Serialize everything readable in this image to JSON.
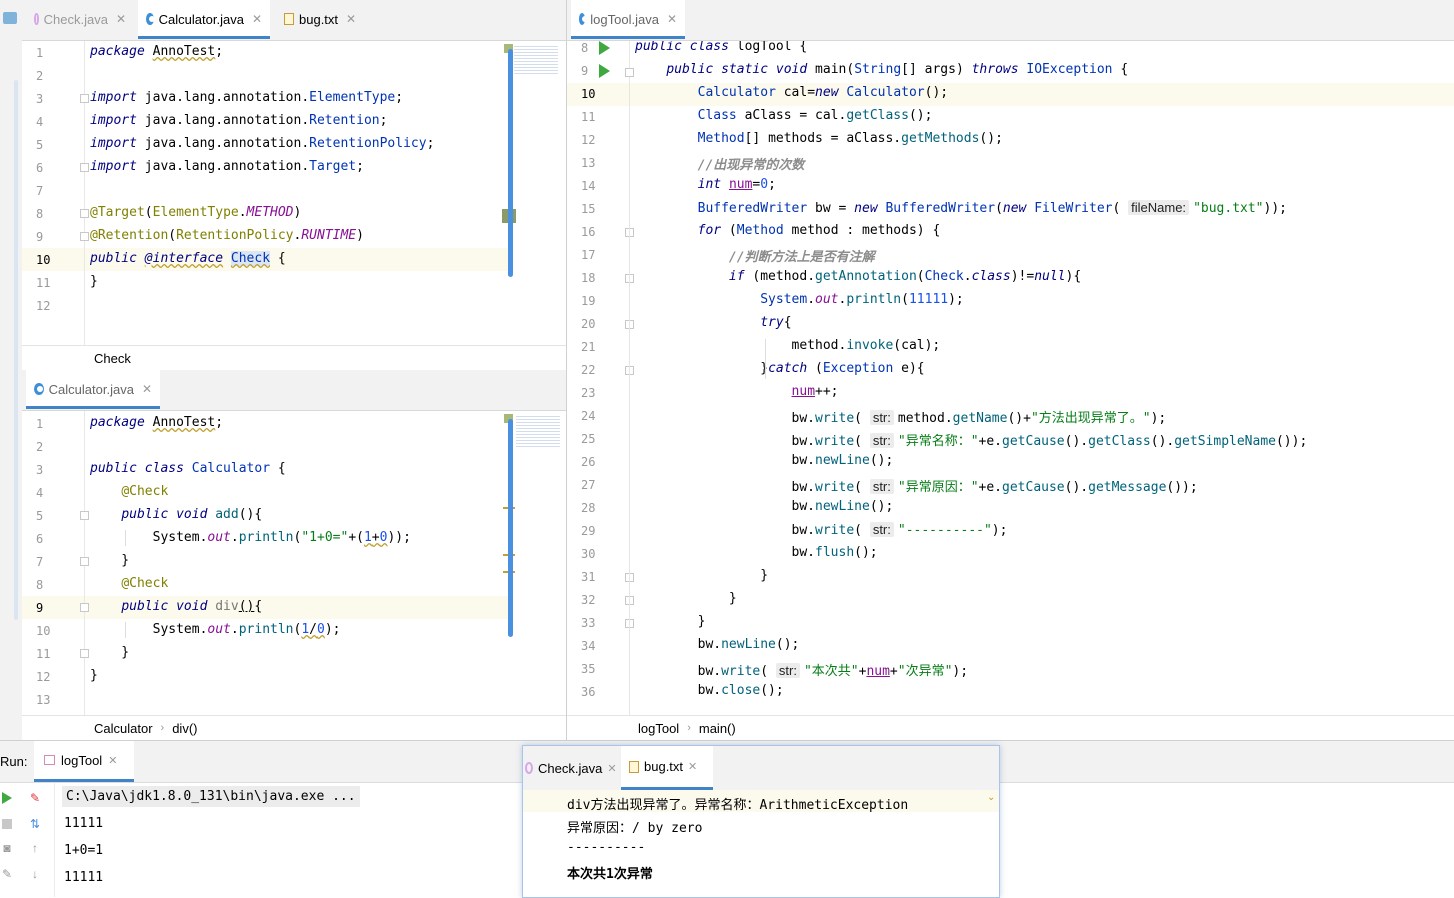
{
  "left_top_editor": {
    "tabs": [
      {
        "label": "Check.java",
        "icon": "annotation-icon",
        "state": "inactive"
      },
      {
        "label": "Calculator.java",
        "icon": "java-class-icon",
        "state": "active"
      },
      {
        "label": "bug.txt",
        "icon": "text-file-icon",
        "state": "inactive"
      }
    ],
    "line_numbers": [
      "1",
      "2",
      "3",
      "4",
      "5",
      "6",
      "7",
      "8",
      "9",
      "10",
      "11",
      "12"
    ],
    "lines": [
      "package AnnoTest;",
      "",
      "import java.lang.annotation.ElementType;",
      "import java.lang.annotation.Retention;",
      "import java.lang.annotation.RetentionPolicy;",
      "import java.lang.annotation.Target;",
      "",
      "@Target(ElementType.METHOD)",
      "@Retention(RetentionPolicy.RUNTIME)",
      "public @interface Check {",
      "}",
      ""
    ],
    "current_line": "10",
    "breadcrumb": [
      "Check"
    ]
  },
  "left_bottom_editor": {
    "tabs": [
      {
        "label": "Calculator.java",
        "icon": "java-class-icon",
        "state": "active"
      }
    ],
    "line_numbers": [
      "1",
      "2",
      "3",
      "4",
      "5",
      "6",
      "7",
      "8",
      "9",
      "10",
      "11",
      "12",
      "13"
    ],
    "lines": [
      "package AnnoTest;",
      "",
      "public class Calculator {",
      "    @Check",
      "    public void add(){",
      "        System.out.println(\"1+0=\"+(1+0));",
      "    }",
      "    @Check",
      "    public void div(){",
      "        System.out.println(1/0);",
      "    }",
      "}",
      ""
    ],
    "current_line": "9",
    "breadcrumb": [
      "Calculator",
      "div()"
    ]
  },
  "right_editor": {
    "tabs": [
      {
        "label": "logTool.java",
        "icon": "java-class-icon",
        "state": "active"
      }
    ],
    "line_numbers": [
      "8",
      "9",
      "10",
      "11",
      "12",
      "13",
      "14",
      "15",
      "16",
      "17",
      "18",
      "19",
      "20",
      "21",
      "22",
      "23",
      "24",
      "25",
      "26",
      "27",
      "28",
      "29",
      "30",
      "31",
      "32",
      "33",
      "34",
      "35",
      "36"
    ],
    "lines": [
      "public class logTool {",
      "    public static void main(String[] args) throws IOException {",
      "        Calculator cal=new Calculator();",
      "        Class aClass = cal.getClass();",
      "        Method[] methods = aClass.getMethods();",
      "        //出现异常的次数",
      "        int num=0;",
      "        BufferedWriter bw = new BufferedWriter(new FileWriter( fileName: \"bug.txt\"));",
      "        for (Method method : methods) {",
      "            //判断方法上是否有注解",
      "            if (method.getAnnotation(Check.class)!=null){",
      "                System.out.println(11111);",
      "                try{",
      "                    method.invoke(cal);",
      "                }catch (Exception e){",
      "                    num++;",
      "                    bw.write( str: method.getName()+\"方法出现异常了。\");",
      "                    bw.write( str: \"异常名称：\"+e.getCause().getClass().getSimpleName());",
      "                    bw.newLine();",
      "                    bw.write( str: \"异常原因：\"+e.getCause().getMessage());",
      "                    bw.newLine();",
      "                    bw.write( str: \"----------\");",
      "                    bw.flush();",
      "                }",
      "            }",
      "        }",
      "        bw.newLine();",
      "        bw.write( str: \"本次共\"+num+\"次异常\");",
      "        bw.close();"
    ],
    "current_line": "10",
    "breadcrumb": [
      "logTool",
      "main()"
    ]
  },
  "run_panel": {
    "label": "Run:",
    "tab": "logTool",
    "output": [
      "C:\\Java\\jdk1.8.0_131\\bin\\java.exe ...",
      "11111",
      "1+0=1",
      "11111"
    ]
  },
  "floating_editor": {
    "tabs": [
      {
        "label": "Check.java",
        "icon": "annotation-icon",
        "state": "inactive"
      },
      {
        "label": "bug.txt",
        "icon": "text-file-icon",
        "state": "active"
      }
    ],
    "lines": [
      "div方法出现异常了。异常名称：ArithmeticException",
      "异常原因：/ by zero",
      "----------",
      "本次共1次异常"
    ]
  },
  "colors": {
    "tab_underline": "#4083c9",
    "scrollbar": "#4a90e0",
    "keyword": "#000080",
    "string": "#067d17",
    "number": "#1750eb",
    "annotation": "#808000",
    "field": "#871094",
    "method_call": "#00627a",
    "comment": "#8c8c8c",
    "current_line_bg": "#fcfaed",
    "run_icon": "#3fa83f",
    "stop_icon": "#d33"
  }
}
